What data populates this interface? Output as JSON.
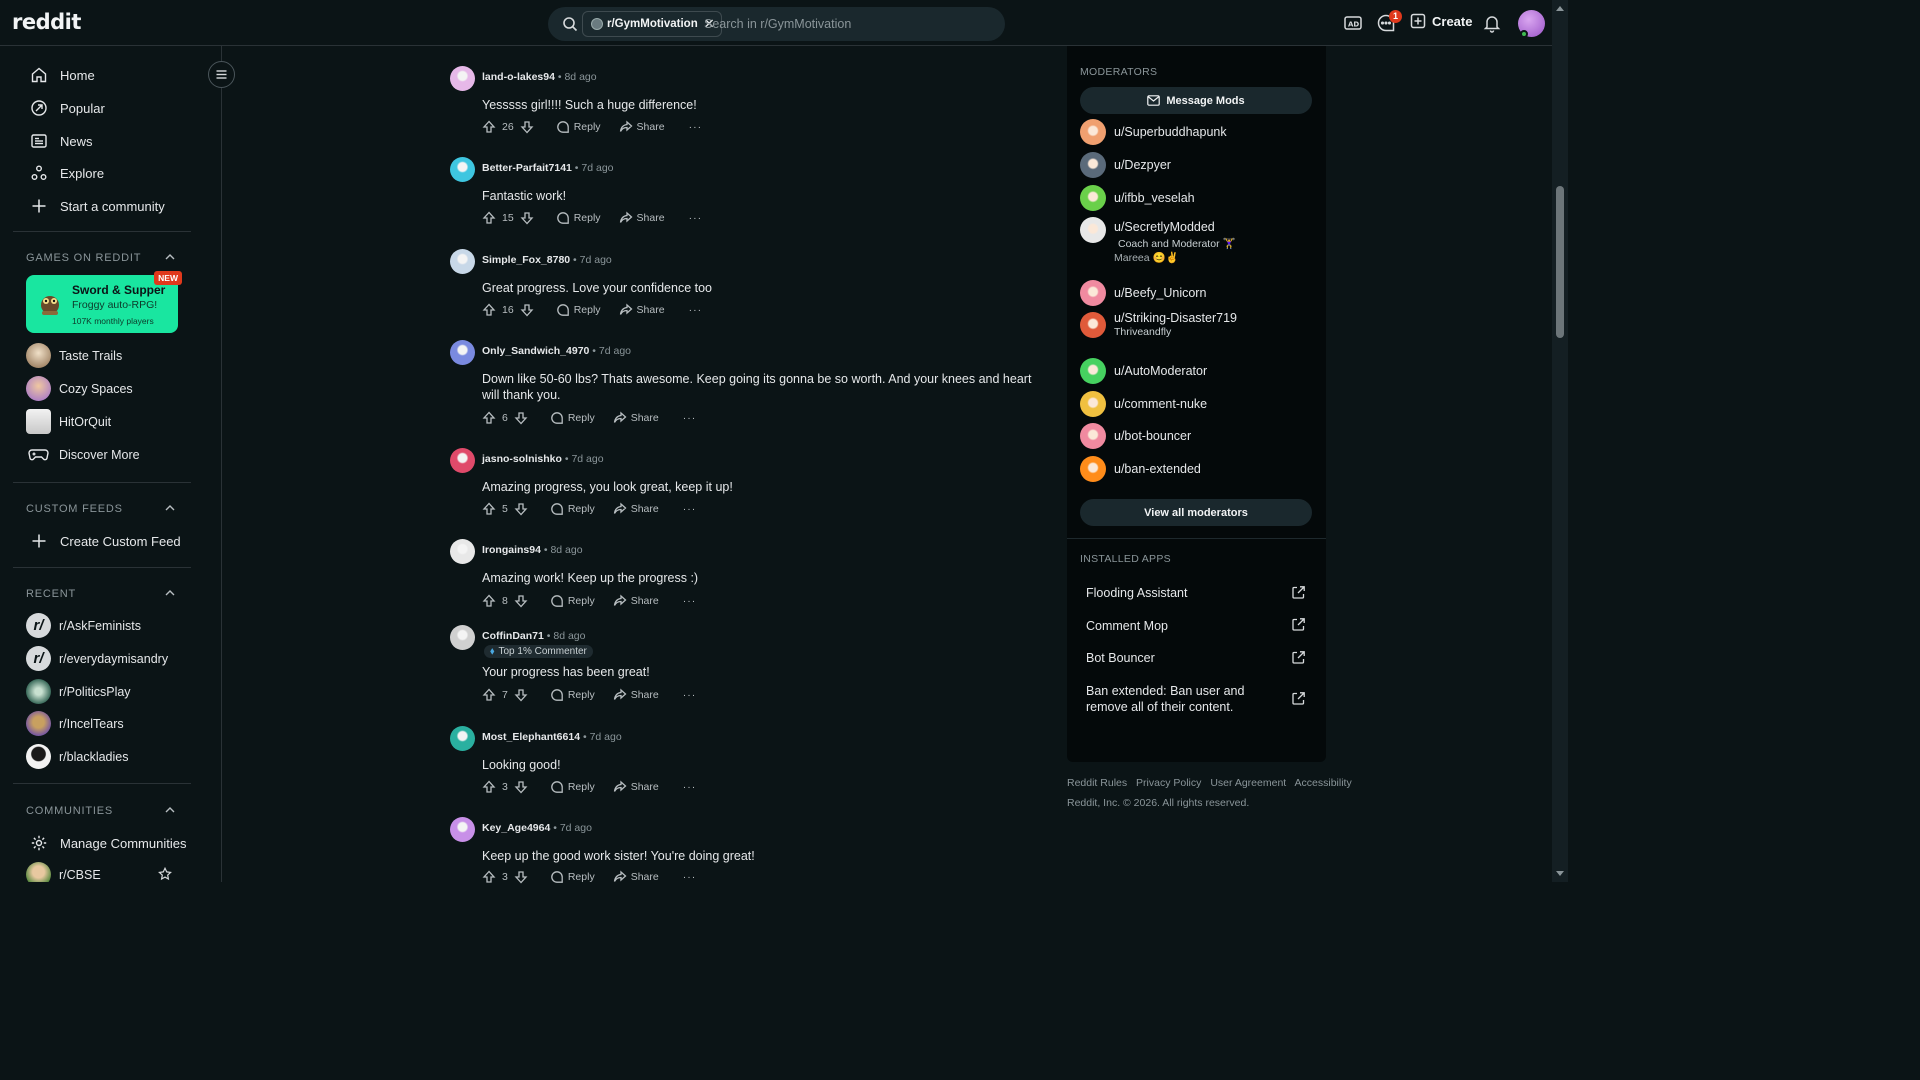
{
  "header": {
    "logo": "reddit",
    "search_chip": "r/GymMotivation",
    "search_placeholder": "Search in r/GymMotivation",
    "chat_badge": "1",
    "create_label": "Create"
  },
  "sidebar": {
    "nav": [
      {
        "label": "Home",
        "icon": "home-icon"
      },
      {
        "label": "Popular",
        "icon": "popular-icon"
      },
      {
        "label": "News",
        "icon": "news-icon"
      },
      {
        "label": "Explore",
        "icon": "explore-icon"
      },
      {
        "label": "Start a community",
        "icon": "plus-icon"
      }
    ],
    "games_title": "GAMES ON REDDIT",
    "game_card": {
      "title": "Sword & Supper",
      "subtitle": "Froggy auto-RPG!",
      "players": "107K monthly players",
      "badge": "NEW"
    },
    "games": [
      {
        "label": "Taste Trails",
        "color": "#c9b8a0"
      },
      {
        "label": "Cozy Spaces",
        "color": "#b08ad9"
      },
      {
        "label": "HitOrQuit",
        "color": "#e8e8e8"
      },
      {
        "label": "Discover More",
        "color": ""
      }
    ],
    "custom_feeds_title": "CUSTOM FEEDS",
    "create_custom_feed": "Create Custom Feed",
    "recent_title": "RECENT",
    "recent": [
      {
        "label": "r/AskFeminists",
        "color": "#d7dadc"
      },
      {
        "label": "r/everydaymisandry",
        "color": "#d7dadc"
      },
      {
        "label": "r/PoliticsPlay",
        "color": "#4a7a6a"
      },
      {
        "label": "r/IncelTears",
        "color": "#8a6aa8"
      },
      {
        "label": "r/blackladies",
        "color": "#f2f2f2"
      }
    ],
    "communities_title": "COMMUNITIES",
    "manage_communities": "Manage Communities",
    "communities": [
      {
        "label": "r/CBSE",
        "color": "#7aa860"
      }
    ]
  },
  "comments": [
    {
      "author": "land-o-lakes94",
      "time": "8d ago",
      "body": "Yesssss girl!!!! Such a huge difference!",
      "votes": "26",
      "avatar": "#e6b8e8"
    },
    {
      "author": "Better-Parfait7141",
      "time": "7d ago",
      "body": "Fantastic work!",
      "votes": "15",
      "avatar": "#3ec6e0"
    },
    {
      "author": "Simple_Fox_8780",
      "time": "7d ago",
      "body": "Great progress. Love your confidence too",
      "votes": "16",
      "avatar": "#c8d8e8"
    },
    {
      "author": "Only_Sandwich_4970",
      "time": "7d ago",
      "body": "Down like 50-60 lbs? Thats awesome. Keep going its gonna be so worth. And your knees and heart will thank you.",
      "votes": "6",
      "avatar": "#7a8ae0"
    },
    {
      "author": "jasno-solnishko",
      "time": "7d ago",
      "body": "Amazing progress, you look great, keep it up!",
      "votes": "5",
      "avatar": "#e04a6a"
    },
    {
      "author": "Irongains94",
      "time": "8d ago",
      "body": "Amazing work! Keep up the progress :)",
      "votes": "8",
      "avatar": "#e8e8e8"
    },
    {
      "author": "CoffinDan71",
      "time": "8d ago",
      "flair": "Top 1% Commenter",
      "body": "Your progress has been great!",
      "votes": "7",
      "avatar": "#d0d0d0"
    },
    {
      "author": "Most_Elephant6614",
      "time": "7d ago",
      "body": "Looking good!",
      "votes": "3",
      "avatar": "#2ab0a0"
    },
    {
      "author": "Key_Age4964",
      "time": "7d ago",
      "body": "Keep up the good work sister! You're doing great!",
      "votes": "3",
      "avatar": "#c890e8"
    }
  ],
  "actions": {
    "reply": "Reply",
    "share": "Share",
    "more": "···"
  },
  "right": {
    "moderators_title": "MODERATORS",
    "message_mods": "Message Mods",
    "mods": [
      {
        "name": "u/Superbuddhapunk",
        "avatar": "#f0a070",
        "flair": ""
      },
      {
        "name": "u/Dezpyer",
        "avatar": "#5a6a7a",
        "flair": ""
      },
      {
        "name": "u/ifbb_veselah",
        "avatar": "#6ad04a",
        "flair": ""
      },
      {
        "name": "u/SecretlyModded",
        "avatar": "#e8e8e8",
        "flair": "Coach and Moderator 🏋️‍♀️",
        "flair2": "Mareea 😊✌️"
      },
      {
        "name": "u/Beefy_Unicorn",
        "avatar": "#f08aa0",
        "flair": ""
      },
      {
        "name": "u/Striking-Disaster719",
        "avatar": "#e05a3a",
        "flair": "Thriveandfly"
      },
      {
        "name": "u/AutoModerator",
        "avatar": "#46d160",
        "flair": ""
      },
      {
        "name": "u/comment-nuke",
        "avatar": "#f0c040",
        "flair": ""
      },
      {
        "name": "u/bot-bouncer",
        "avatar": "#f08aa0",
        "flair": ""
      },
      {
        "name": "u/ban-extended",
        "avatar": "#ff8c1a",
        "flair": ""
      }
    ],
    "view_all": "View all moderators",
    "installed_title": "INSTALLED APPS",
    "apps": [
      "Flooding Assistant",
      "Comment Mop",
      "Bot Bouncer",
      "Ban extended: Ban user and remove all of their content."
    ]
  },
  "footer": {
    "links": [
      "Reddit Rules",
      "Privacy Policy",
      "User Agreement",
      "Accessibility"
    ],
    "copyright": "Reddit, Inc. © 2026. All rights reserved."
  }
}
